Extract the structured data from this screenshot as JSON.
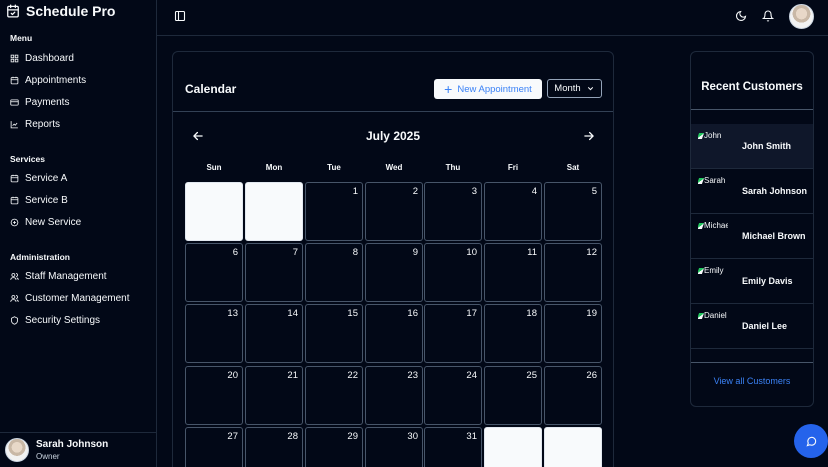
{
  "app": {
    "title": "Schedule Pro"
  },
  "sidebar": {
    "sections": [
      {
        "label": "Menu",
        "items": [
          {
            "label": "Dashboard",
            "icon": "dashboard-icon"
          },
          {
            "label": "Appointments",
            "icon": "calendar-icon"
          },
          {
            "label": "Payments",
            "icon": "credit-card-icon"
          },
          {
            "label": "Reports",
            "icon": "chart-icon"
          }
        ]
      },
      {
        "label": "Services",
        "items": [
          {
            "label": "Service A",
            "icon": "calendar-icon"
          },
          {
            "label": "Service B",
            "icon": "calendar-icon"
          },
          {
            "label": "New Service",
            "icon": "plus-circle-icon"
          }
        ]
      },
      {
        "label": "Administration",
        "items": [
          {
            "label": "Staff Management",
            "icon": "users-icon"
          },
          {
            "label": "Customer Management",
            "icon": "users-icon"
          },
          {
            "label": "Security Settings",
            "icon": "shield-icon"
          }
        ]
      }
    ],
    "user": {
      "name": "Sarah Johnson",
      "role": "Owner"
    }
  },
  "calendar": {
    "title": "Calendar",
    "new_button": "New Appointment",
    "view_select": "Month",
    "month_label": "July 2025",
    "weekdays": [
      "Sun",
      "Mon",
      "Tue",
      "Wed",
      "Thu",
      "Fri",
      "Sat"
    ],
    "days": [
      "",
      "",
      "1",
      "2",
      "3",
      "4",
      "5",
      "6",
      "7",
      "8",
      "9",
      "10",
      "11",
      "12",
      "13",
      "14",
      "15",
      "16",
      "17",
      "18",
      "19",
      "20",
      "21",
      "22",
      "23",
      "24",
      "25",
      "26",
      "27",
      "28",
      "29",
      "30",
      "31",
      "",
      ""
    ]
  },
  "customers": {
    "title": "Recent Customers",
    "items": [
      {
        "alt": "John",
        "name": "John Smith"
      },
      {
        "alt": "Sarah",
        "name": "Sarah Johnson"
      },
      {
        "alt": "Michael",
        "name": "Michael Brown"
      },
      {
        "alt": "Emily",
        "name": "Emily Davis"
      },
      {
        "alt": "Daniel",
        "name": "Daniel Lee"
      }
    ],
    "view_all": "View all Customers"
  },
  "colors": {
    "accent": "#3b82f6",
    "background": "#020817",
    "border": "#1e293b",
    "fab": "#2563eb"
  }
}
